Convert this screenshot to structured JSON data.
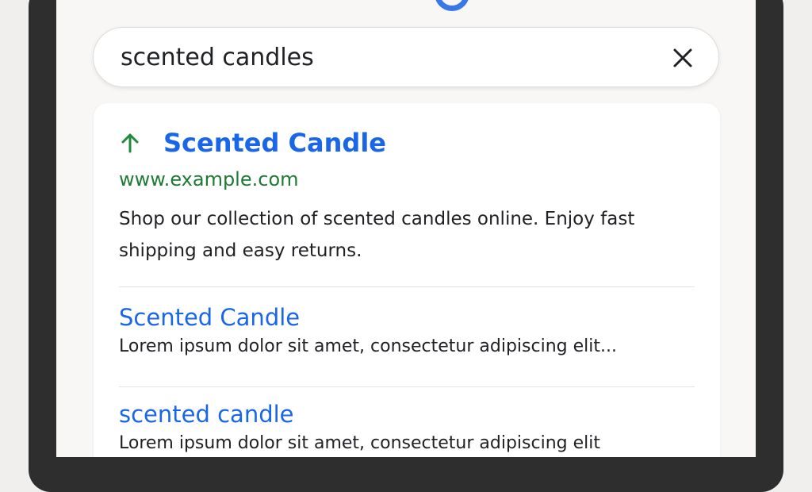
{
  "search": {
    "query": "scented candles"
  },
  "top_result": {
    "title": "Scented Candle",
    "url": "www.example.com",
    "snippet": "Shop our collection of scented candles online. Enjoy fast shipping and easy returns."
  },
  "results": [
    {
      "title": "Scented Candle",
      "snippet": "Lorem ipsum dolor sit amet, consectetur adipiscing elit..."
    },
    {
      "title": "scented candle",
      "snippet": "Lorem ipsum dolor sit amet, consectetur adipiscing elit"
    }
  ],
  "icons": {
    "logo": "google-logo-icon",
    "clear": "close-icon",
    "arrow": "arrow-up-icon"
  },
  "colors": {
    "link": "#1a66e8",
    "url": "#1e7a35",
    "arrow": "#1e8a3c",
    "logo": "#3b78e7"
  }
}
